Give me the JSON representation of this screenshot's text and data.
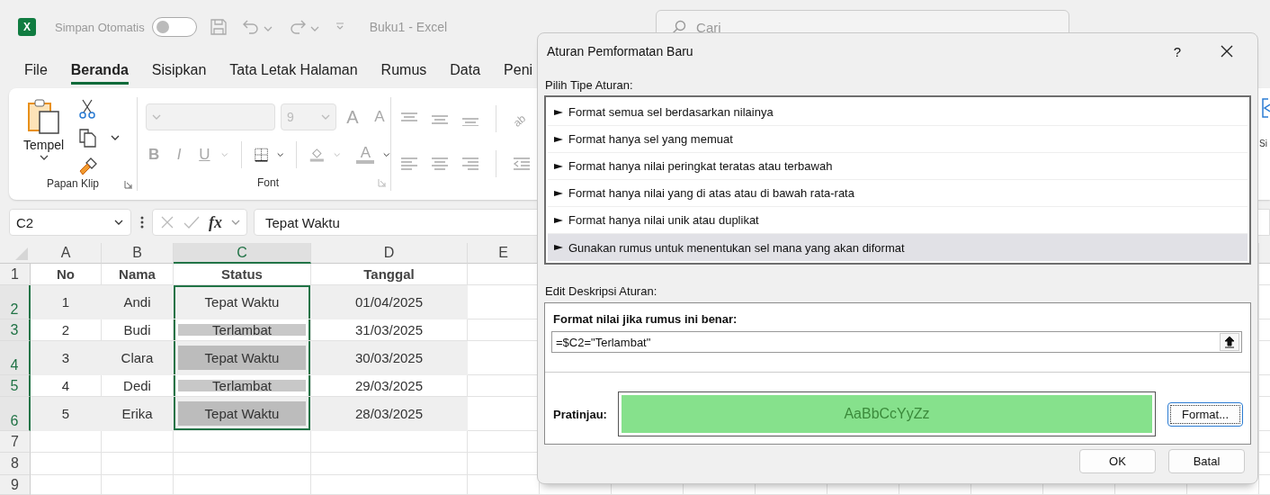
{
  "app_bar": {
    "logo": "X",
    "autosave_label": "Simpan Otomatis",
    "autosave_on": false,
    "document_title": "Buku1  -  Excel",
    "search_placeholder": "Cari"
  },
  "ribbon_tabs": [
    {
      "label": "File",
      "selected": false
    },
    {
      "label": "Beranda",
      "selected": true
    },
    {
      "label": "Sisipkan",
      "selected": false
    },
    {
      "label": "Tata Letak Halaman",
      "selected": false
    },
    {
      "label": "Rumus",
      "selected": false
    },
    {
      "label": "Data",
      "selected": false
    },
    {
      "label": "Peni",
      "selected": false
    }
  ],
  "ribbon": {
    "paste_label": "Tempel",
    "clipboard_label": "Papan Klip",
    "font_size": "9",
    "grow_font": "A",
    "shrink_font": "A",
    "bold": "B",
    "italic": "I",
    "underline": "U",
    "font_color": "A",
    "font_label": "Font",
    "orientation": "ab",
    "side_label": "Si"
  },
  "formula_bar": {
    "name_box": "C2",
    "function_label": "fx",
    "formula": "Tepat Waktu"
  },
  "sheet": {
    "columns": [
      {
        "label": "A",
        "selected": false
      },
      {
        "label": "B",
        "selected": false
      },
      {
        "label": "C",
        "selected": true
      },
      {
        "label": "D",
        "selected": false
      },
      {
        "label": "E",
        "selected": false
      }
    ],
    "rows": [
      {
        "label": "1",
        "kind": "header",
        "selected": false,
        "banded": false,
        "cells": [
          {
            "text": "No",
            "selected": false,
            "active": false
          },
          {
            "text": "Nama",
            "selected": false,
            "active": false
          },
          {
            "text": "Status",
            "selected": false,
            "active": false
          },
          {
            "text": "Tanggal",
            "selected": false,
            "active": false
          }
        ]
      },
      {
        "label": "2",
        "kind": "data",
        "selected": true,
        "banded": true,
        "cells": [
          {
            "text": "1",
            "selected": false,
            "active": false
          },
          {
            "text": "Andi",
            "selected": false,
            "active": false
          },
          {
            "text": "Tepat Waktu",
            "selected": true,
            "active": true
          },
          {
            "text": "01/04/2025",
            "selected": false,
            "active": false
          }
        ]
      },
      {
        "label": "3",
        "kind": "data",
        "selected": true,
        "banded": false,
        "cells": [
          {
            "text": "2",
            "selected": false,
            "active": false
          },
          {
            "text": "Budi",
            "selected": false,
            "active": false
          },
          {
            "text": "Terlambat",
            "selected": true,
            "active": false
          },
          {
            "text": "31/03/2025",
            "selected": false,
            "active": false
          }
        ]
      },
      {
        "label": "4",
        "kind": "data",
        "selected": true,
        "banded": true,
        "cells": [
          {
            "text": "3",
            "selected": false,
            "active": false
          },
          {
            "text": "Clara",
            "selected": false,
            "active": false
          },
          {
            "text": "Tepat Waktu",
            "selected": true,
            "active": false
          },
          {
            "text": "30/03/2025",
            "selected": false,
            "active": false
          }
        ]
      },
      {
        "label": "5",
        "kind": "data",
        "selected": true,
        "banded": false,
        "cells": [
          {
            "text": "4",
            "selected": false,
            "active": false
          },
          {
            "text": "Dedi",
            "selected": false,
            "active": false
          },
          {
            "text": "Terlambat",
            "selected": true,
            "active": false
          },
          {
            "text": "29/03/2025",
            "selected": false,
            "active": false
          }
        ]
      },
      {
        "label": "6",
        "kind": "data",
        "selected": true,
        "banded": true,
        "cells": [
          {
            "text": "5",
            "selected": false,
            "active": false
          },
          {
            "text": "Erika",
            "selected": false,
            "active": false
          },
          {
            "text": "Tepat Waktu",
            "selected": true,
            "active": false
          },
          {
            "text": "28/03/2025",
            "selected": false,
            "active": false
          }
        ]
      },
      {
        "label": "7",
        "kind": "empty",
        "selected": false,
        "banded": false
      },
      {
        "label": "8",
        "kind": "empty",
        "selected": false,
        "banded": false
      },
      {
        "label": "9",
        "kind": "empty",
        "selected": false,
        "banded": false
      }
    ]
  },
  "dialog": {
    "title": "Aturan Pemformatan Baru",
    "help": "?",
    "rule_type_label": "Pilih Tipe Aturan:",
    "rule_types": [
      {
        "label": "Format semua sel berdasarkan nilainya",
        "selected": false
      },
      {
        "label": "Format hanya sel yang memuat",
        "selected": false
      },
      {
        "label": "Format hanya nilai peringkat teratas atau terbawah",
        "selected": false
      },
      {
        "label": "Format hanya nilai yang di atas atau di bawah rata-rata",
        "selected": false
      },
      {
        "label": "Format hanya nilai unik atau duplikat",
        "selected": false
      },
      {
        "label": "Gunakan rumus untuk menentukan sel mana yang akan diformat",
        "selected": true
      }
    ],
    "description_label": "Edit Deskripsi Aturan:",
    "formula_label": "Format nilai jika rumus ini benar:",
    "formula": "=$C2=\"Terlambat\"",
    "preview_label": "Pratinjau:",
    "preview_text": "AaBbCcYyZz",
    "format_button": "Format...",
    "ok_button": "OK",
    "cancel_button": "Batal"
  }
}
